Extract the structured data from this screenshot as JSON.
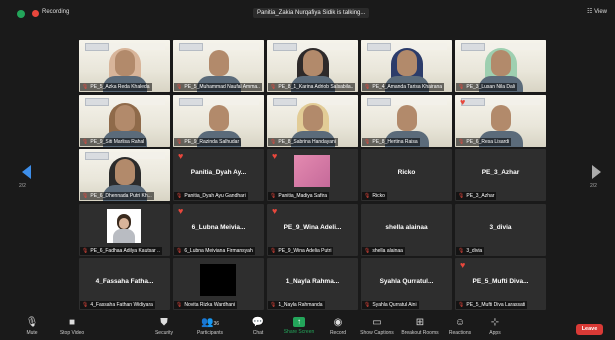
{
  "top": {
    "recording": "Recording",
    "talking": "Panitia_Zakia Nurqafiya Sidik is talking...",
    "view": "View"
  },
  "pagination": {
    "left": "2/2",
    "right": "2/2"
  },
  "tiles": [
    {
      "name": "PE_5_Azka Reda Khaleda",
      "video": true,
      "hijab": "#d8b59a"
    },
    {
      "name": "PE_5_Muhammad Naufal Amma..",
      "video": true,
      "hijab": ""
    },
    {
      "name": "PE_8_1_Karina Adriob Salsabila..",
      "video": true,
      "hijab": "#2e2a2a"
    },
    {
      "name": "PE_4_Amanda Tarisa Khairana",
      "video": true,
      "hijab": "#2c3c6a"
    },
    {
      "name": "PE_3_Lusan Nila Dali",
      "video": true,
      "hijab": "#9ecfb0"
    },
    {
      "name": "PE_9_Siti Marlisa Rahal",
      "video": true,
      "hijab": "#8f6a4a"
    },
    {
      "name": "PE_9_Razinda Salhudar",
      "video": true,
      "hijab": ""
    },
    {
      "name": "PE_8_Sabrina Handayani",
      "video": true,
      "hijab": "#e2cc96"
    },
    {
      "name": "PE_8_Hertina Raisa",
      "video": true,
      "hijab": ""
    },
    {
      "name": "PE_6_Resa Lisardi",
      "video": true,
      "hijab": "",
      "heart": true
    },
    {
      "name": "PE_6_Dhennada Putri Kh...",
      "video": true,
      "hijab": "#2b2b2b"
    },
    {
      "center": "Panitia_Dyah Ay...",
      "name": "Panitia_Dyah Ayu Gandhari",
      "heart": true
    },
    {
      "center": "",
      "name": "Panitia_Madiya Safira",
      "heart": true,
      "box": "pink"
    },
    {
      "center": "Ricko",
      "name": "Ricko"
    },
    {
      "center": "PE_3_Azhar",
      "name": "PE_3_Azhar"
    },
    {
      "center": "",
      "name": "PE_6_Fadhaa Adilya Kautsar ..",
      "box": "avatar"
    },
    {
      "center": "6_Lubna Meivia...",
      "name": "6_Lubna Meiviana Firmansyah",
      "heart": true
    },
    {
      "center": "PE_9_Wina Adeli...",
      "name": "PE_9_Wina Adelia Putri",
      "heart": true
    },
    {
      "center": "shella alainaa",
      "name": "shella alainaa"
    },
    {
      "center": "3_divia",
      "name": "3_divia"
    },
    {
      "center": "4_Fassaha Fatha...",
      "name": "4_Fassaha Fathan Widiyara"
    },
    {
      "center": "",
      "name": "Novita Rizka Wardhani",
      "box": "black"
    },
    {
      "center": "1_Nayla Rahma...",
      "name": "1_Nayla Rahmanda"
    },
    {
      "center": "Syahla Qurratul...",
      "name": "Syahla Qurratul Aini"
    },
    {
      "center": "PE_5_Mufti Diva...",
      "name": "PE_5_Mufti Diva Larassati",
      "heart": true
    }
  ],
  "toolbar": {
    "mute": "Mute",
    "stop_video": "Stop Video",
    "security": "Security",
    "participants": "Participants",
    "participants_count": "36",
    "chat": "Chat",
    "share": "Share Screen",
    "record": "Record",
    "captions": "Show Captions",
    "breakout": "Breakout Rooms",
    "reactions": "Reactions",
    "apps": "Apps",
    "leave": "Leave"
  },
  "colors": {
    "accent_green": "#23a55a",
    "leave_red": "#d93a36",
    "nav_blue": "#3d8eea"
  }
}
